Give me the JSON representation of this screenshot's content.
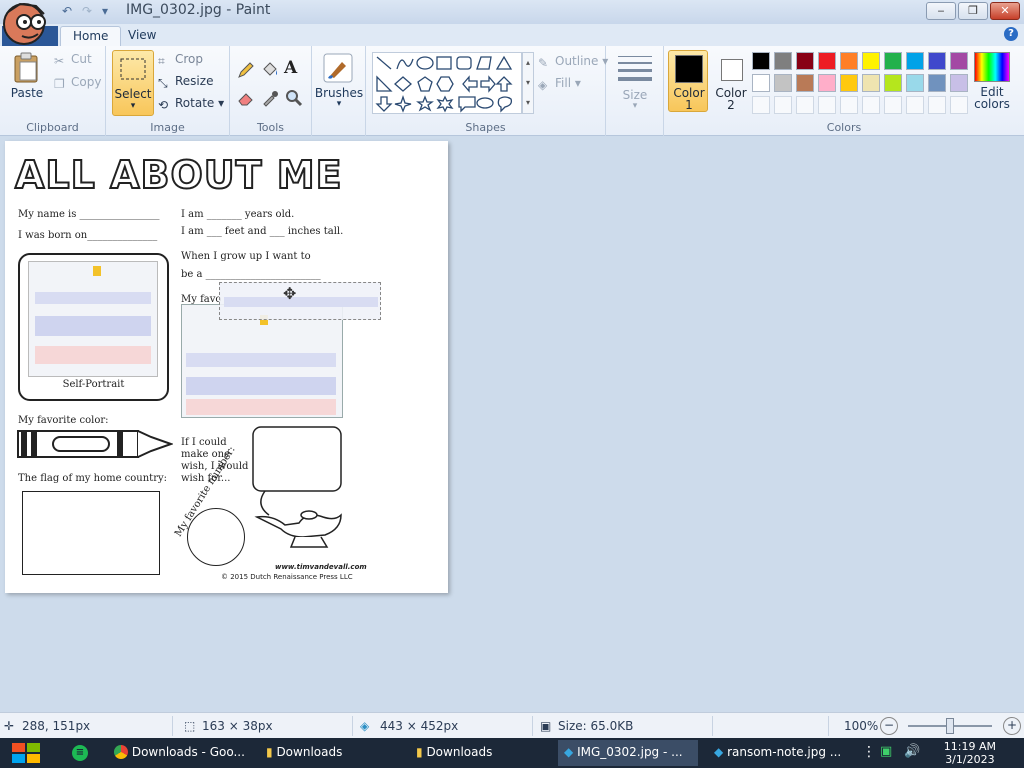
{
  "window": {
    "title": "IMG_0302.jpg - Paint",
    "controls": {
      "minimize": "▭",
      "maximize": "▭",
      "close": "✕"
    }
  },
  "tabs": [
    "Home",
    "View"
  ],
  "ribbon": {
    "clipboard": {
      "paste": "Paste",
      "cut": "Cut",
      "copy": "Copy",
      "label": "Clipboard"
    },
    "image": {
      "select": "Select",
      "crop": "Crop",
      "resize": "Resize",
      "rotate": "Rotate",
      "label": "Image"
    },
    "tools": {
      "label": "Tools"
    },
    "brushes": {
      "label": "Brushes"
    },
    "shapes": {
      "outline": "Outline",
      "fill": "Fill",
      "label": "Shapes"
    },
    "size": {
      "label": "Size"
    },
    "colors": {
      "color1": "Color 1",
      "color2": "Color 2",
      "edit": "Edit colors",
      "label": "Colors",
      "color1_value": "#000000",
      "color2_value": "#ffffff",
      "palette_row1": [
        "#000000",
        "#7f7f7f",
        "#880015",
        "#ed1c24",
        "#ff7f27",
        "#fff200",
        "#22b14c",
        "#00a2e8",
        "#3f48cc",
        "#a349a4"
      ],
      "palette_row2": [
        "#ffffff",
        "#c3c3c3",
        "#b97a57",
        "#ffaec9",
        "#ffc90e",
        "#efe4b0",
        "#b5e61d",
        "#99d9ea",
        "#7092be",
        "#c8bfe7"
      ]
    }
  },
  "worksheet": {
    "title": "ALL ABOUT ME",
    "name_line": "My name is ________________",
    "born_line": "I was born on______________",
    "age_line": "I am _______ years old.",
    "height_line": "I am ___ feet and ___ inches tall.",
    "grow_line1": "When I grow up I want to",
    "grow_line2": "be a _______________________",
    "favorite_partial": "My favo",
    "self_portrait": "Self-Portrait",
    "fav_color": "My favorite color:",
    "wish": [
      "If I could",
      "make one",
      "wish, I would",
      "wish for..."
    ],
    "flag": "The flag of my home country:",
    "fav_number": "My favorite number:",
    "website": "www.timvandevall.com",
    "copyright": "© 2015 Dutch Renaissance Press LLC"
  },
  "status": {
    "cursor": "288, 151px",
    "selection": "163 × 38px",
    "image_size": "443 × 452px",
    "file_size": "Size: 65.0KB",
    "zoom": "100%"
  },
  "taskbar": {
    "items": [
      "Downloads - Goo...",
      "Downloads",
      "Downloads",
      "IMG_0302.jpg - ...",
      "ransom-note.jpg ..."
    ],
    "time": "11:19 AM",
    "date": "3/1/2023"
  }
}
